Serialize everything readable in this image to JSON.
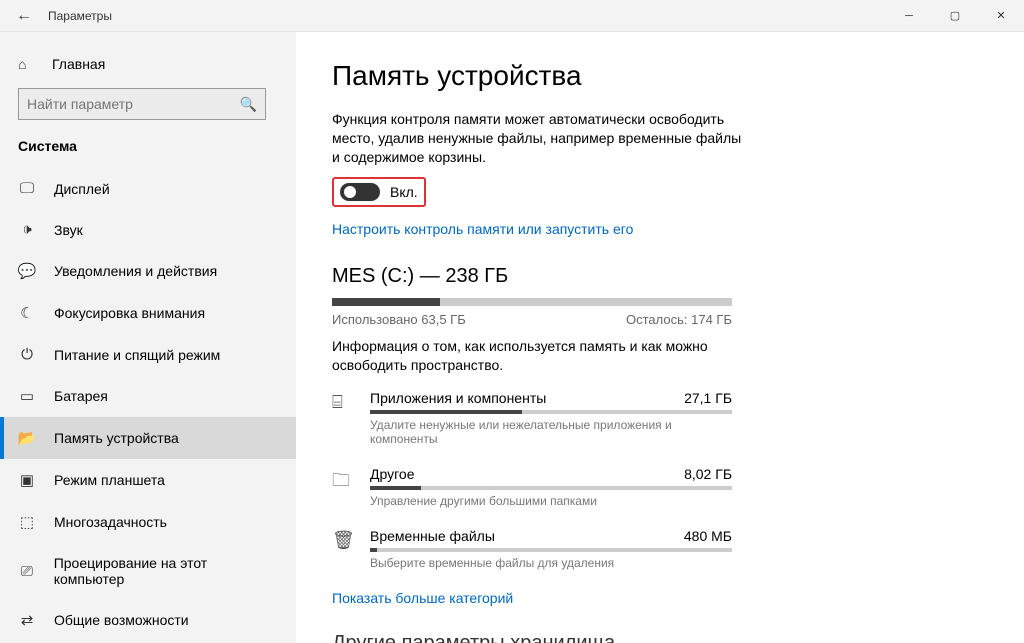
{
  "window": {
    "title": "Параметры"
  },
  "sidebar": {
    "home": "Главная",
    "search_placeholder": "Найти параметр",
    "section": "Система",
    "items": [
      {
        "icon": "display",
        "label": "Дисплей"
      },
      {
        "icon": "sound",
        "label": "Звук"
      },
      {
        "icon": "notify",
        "label": "Уведомления и действия"
      },
      {
        "icon": "focus",
        "label": "Фокусировка внимания"
      },
      {
        "icon": "power",
        "label": "Питание и спящий режим"
      },
      {
        "icon": "battery",
        "label": "Батарея"
      },
      {
        "icon": "storage",
        "label": "Память устройства"
      },
      {
        "icon": "tablet",
        "label": "Режим планшета"
      },
      {
        "icon": "multitask",
        "label": "Многозадачность"
      },
      {
        "icon": "project",
        "label": "Проецирование на этот компьютер"
      },
      {
        "icon": "shared",
        "label": "Общие возможности"
      }
    ],
    "selected_index": 6
  },
  "main": {
    "heading": "Память устройства",
    "description": "Функция контроля памяти может автоматически освободить место, удалив ненужные файлы, например временные файлы и содержимое корзины.",
    "toggle_label": "Вкл.",
    "toggle_on": true,
    "configure_link": "Настроить контроль памяти или запустить его",
    "drive": {
      "title": "MES (C:) — 238 ГБ",
      "used_label": "Использовано 63,5 ГБ",
      "free_label": "Осталось: 174 ГБ",
      "used_percent": 27,
      "info": "Информация о том, как используется память и как можно освободить пространство."
    },
    "categories": [
      {
        "icon": "apps",
        "name": "Приложения и компоненты",
        "size": "27,1 ГБ",
        "fill": 42,
        "sub": "Удалите ненужные или нежелательные приложения и компоненты"
      },
      {
        "icon": "other",
        "name": "Другое",
        "size": "8,02 ГБ",
        "fill": 14,
        "sub": "Управление другими большими папками"
      },
      {
        "icon": "temp",
        "name": "Временные файлы",
        "size": "480 МБ",
        "fill": 2,
        "sub": "Выберите временные файлы для удаления"
      }
    ],
    "more_categories": "Показать больше категорий",
    "next_heading": "Другие параметры хранилища"
  },
  "icons": {
    "home": "⌂",
    "display": "🖵",
    "sound": "🕩",
    "notify": "💬",
    "focus": "☾",
    "power": "⏻",
    "battery": "▭",
    "storage": "📂",
    "tablet": "▣",
    "multitask": "⬚",
    "project": "⎚",
    "shared": "⇄",
    "search": "🔍",
    "apps": "⌸",
    "other": "🗀",
    "temp": "🗑"
  }
}
